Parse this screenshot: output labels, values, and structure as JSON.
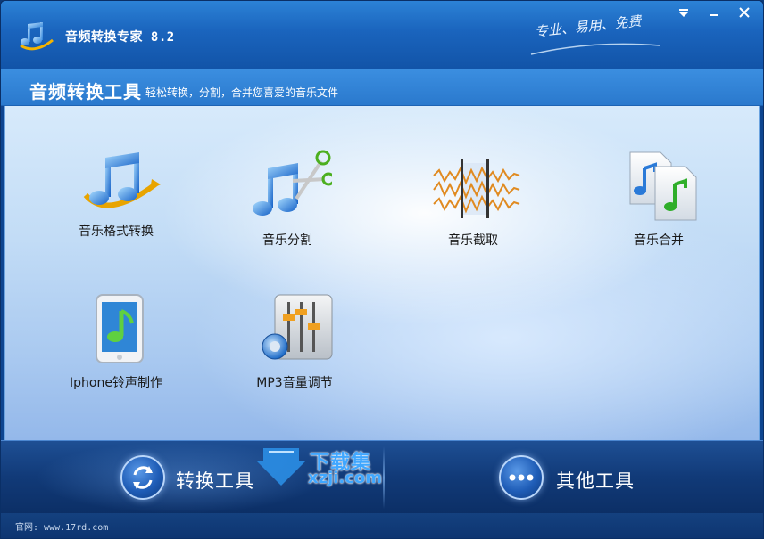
{
  "app": {
    "title": "音频转换专家 8.2",
    "slogan": "专业、易用、免费"
  },
  "window_controls": {
    "menu_icon": "dropdown-arrow-icon",
    "minimize_icon": "minimize-icon",
    "close_icon": "close-icon"
  },
  "header": {
    "title": "音频转换工具",
    "description": "轻松转换，分割，合并您喜爱的音乐文件"
  },
  "tools": [
    {
      "label": "音乐格式转换",
      "icon": "music-convert-icon"
    },
    {
      "label": "音乐分割",
      "icon": "music-split-scissors-icon"
    },
    {
      "label": "音乐截取",
      "icon": "waveform-cut-icon"
    },
    {
      "label": "音乐合并",
      "icon": "music-merge-files-icon"
    },
    {
      "label": "Iphone铃声制作",
      "icon": "iphone-ringtone-icon"
    },
    {
      "label": "MP3音量调节",
      "icon": "volume-mixer-icon"
    }
  ],
  "bottom_tabs": [
    {
      "label": "转换工具",
      "icon": "refresh-icon",
      "active": true
    },
    {
      "label": "其他工具",
      "icon": "more-dots-icon",
      "active": false
    }
  ],
  "watermark": {
    "line1": "下载集",
    "line2": "xzji.com"
  },
  "status": {
    "site": "官网: www.17rd.com"
  },
  "colors": {
    "titlebar": "#1a64bd",
    "content_bg": "#c2dcf6",
    "bottombar": "#113a78",
    "watermark": "#40a7ff"
  }
}
